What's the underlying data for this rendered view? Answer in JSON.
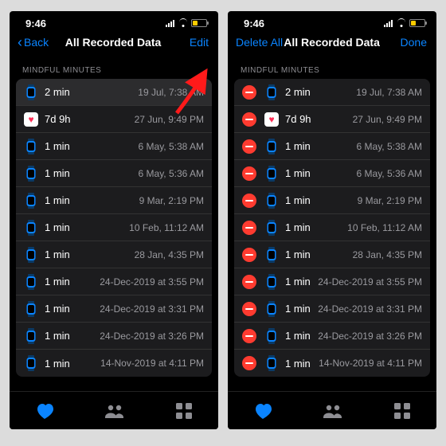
{
  "colors": {
    "accent": "#0a84ff",
    "delete": "#ff3b30",
    "battery": "#ffcc00",
    "heart": "#ff2d55"
  },
  "statusbar": {
    "time": "9:46"
  },
  "screens": [
    {
      "nav": {
        "left_chevron": true,
        "left": "Back",
        "title": "All Recorded Data",
        "right": "Edit"
      },
      "show_arrow": true,
      "edit_mode": false,
      "section": "MINDFUL MINUTES",
      "rows": [
        {
          "icon": "watch",
          "duration": "2 min",
          "timestamp": "19 Jul, 7:38 AM",
          "selected": true
        },
        {
          "icon": "health",
          "duration": "7d 9h",
          "timestamp": "27 Jun, 9:49 PM"
        },
        {
          "icon": "watch",
          "duration": "1 min",
          "timestamp": "6 May, 5:38 AM"
        },
        {
          "icon": "watch",
          "duration": "1 min",
          "timestamp": "6 May, 5:36 AM"
        },
        {
          "icon": "watch",
          "duration": "1 min",
          "timestamp": "9 Mar, 2:19 PM"
        },
        {
          "icon": "watch",
          "duration": "1 min",
          "timestamp": "10 Feb, 11:12 AM"
        },
        {
          "icon": "watch",
          "duration": "1 min",
          "timestamp": "28 Jan, 4:35 PM"
        },
        {
          "icon": "watch",
          "duration": "1 min",
          "timestamp": "24-Dec-2019 at 3:55 PM"
        },
        {
          "icon": "watch",
          "duration": "1 min",
          "timestamp": "24-Dec-2019 at 3:31 PM"
        },
        {
          "icon": "watch",
          "duration": "1 min",
          "timestamp": "24-Dec-2019 at 3:26 PM"
        },
        {
          "icon": "watch",
          "duration": "1 min",
          "timestamp": "14-Nov-2019 at 4:11 PM"
        }
      ]
    },
    {
      "nav": {
        "left_chevron": false,
        "left": "Delete All",
        "title": "All Recorded Data",
        "right": "Done"
      },
      "show_arrow": false,
      "edit_mode": true,
      "section": "MINDFUL MINUTES",
      "rows": [
        {
          "icon": "watch",
          "duration": "2 min",
          "timestamp": "19 Jul, 7:38 AM"
        },
        {
          "icon": "health",
          "duration": "7d 9h",
          "timestamp": "27 Jun, 9:49 PM"
        },
        {
          "icon": "watch",
          "duration": "1 min",
          "timestamp": "6 May, 5:38 AM"
        },
        {
          "icon": "watch",
          "duration": "1 min",
          "timestamp": "6 May, 5:36 AM"
        },
        {
          "icon": "watch",
          "duration": "1 min",
          "timestamp": "9 Mar, 2:19 PM"
        },
        {
          "icon": "watch",
          "duration": "1 min",
          "timestamp": "10 Feb, 11:12 AM"
        },
        {
          "icon": "watch",
          "duration": "1 min",
          "timestamp": "28 Jan, 4:35 PM"
        },
        {
          "icon": "watch",
          "duration": "1 min",
          "timestamp": "24-Dec-2019 at 3:55 PM"
        },
        {
          "icon": "watch",
          "duration": "1 min",
          "timestamp": "24-Dec-2019 at 3:31 PM"
        },
        {
          "icon": "watch",
          "duration": "1 min",
          "timestamp": "24-Dec-2019 at 3:26 PM"
        },
        {
          "icon": "watch",
          "duration": "1 min",
          "timestamp": "14-Nov-2019 at 4:11 PM"
        }
      ]
    }
  ],
  "tabs": [
    {
      "name": "summary",
      "icon": "heart",
      "active": true
    },
    {
      "name": "sharing",
      "icon": "people",
      "active": false
    },
    {
      "name": "browse",
      "icon": "grid",
      "active": false
    }
  ]
}
